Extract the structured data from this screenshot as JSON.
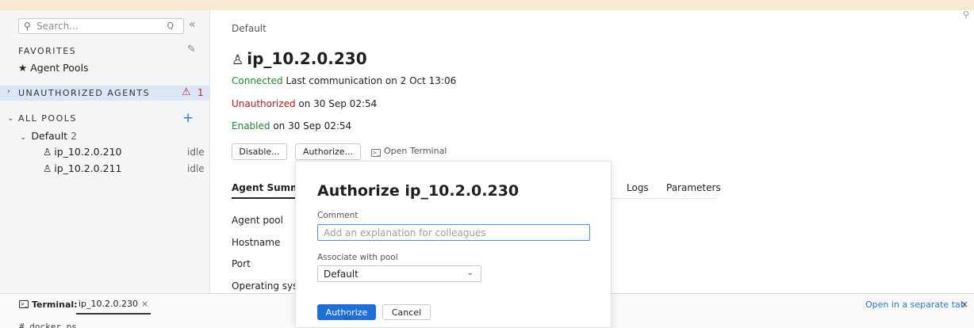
{
  "sidebar": {
    "search_placeholder": "Search...",
    "search_shortcut": "Q",
    "favorites_title": "FAVORITES",
    "favorites_items": [
      "Agent Pools"
    ],
    "unauthorized_title": "UNAUTHORIZED AGENTS",
    "unauthorized_count": "1",
    "all_pools_title": "ALL POOLS",
    "pool": {
      "name": "Default",
      "count": "2"
    },
    "agents": [
      {
        "name": "ip_10.2.0.210",
        "state": "idle"
      },
      {
        "name": "ip_10.2.0.211",
        "state": "idle"
      }
    ]
  },
  "main": {
    "breadcrumb": "Default",
    "title": "ip_10.2.0.230",
    "connection": {
      "status": "Connected",
      "detail": "Last communication on 2 Oct 13:06"
    },
    "authorization": {
      "status": "Unauthorized",
      "detail": "on 30 Sep 02:54"
    },
    "enabled": {
      "status": "Enabled",
      "detail": "on 30 Sep 02:54"
    },
    "buttons": {
      "disable": "Disable...",
      "authorize": "Authorize...",
      "open_terminal": "Open Terminal"
    },
    "tabs": {
      "summary": "Agent Summa",
      "logs": "Logs",
      "parameters": "Parameters"
    },
    "fields": [
      "Agent pool",
      "Hostname",
      "Port",
      "Operating syst"
    ]
  },
  "dialog": {
    "title": "Authorize ip_10.2.0.230",
    "comment_label": "Comment",
    "comment_placeholder": "Add an explanation for colleagues",
    "pool_label": "Associate with pool",
    "pool_value": "Default",
    "authorize_button": "Authorize",
    "cancel_button": "Cancel"
  },
  "terminal": {
    "label": "Terminal:",
    "tab": "ip_10.2.0.230",
    "open_separate": "Open in a separate tab",
    "command": "# docker ps"
  },
  "colors": {
    "accent": "#1e6fd9",
    "connected": "#1b8a2e",
    "unauthorized": "#c3151b",
    "top_band": "#f7ead2"
  }
}
